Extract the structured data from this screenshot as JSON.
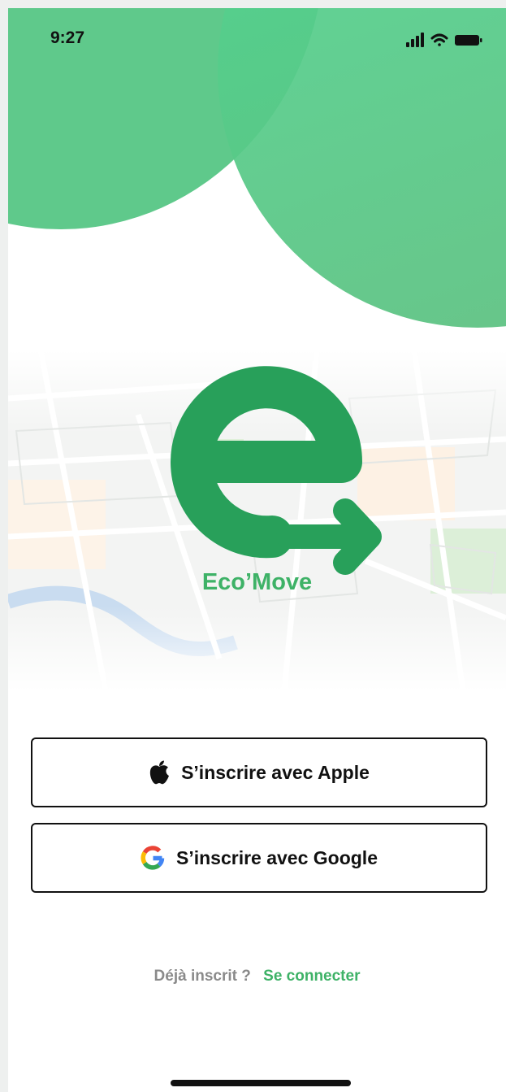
{
  "status_bar": {
    "time": "9:27"
  },
  "brand": {
    "name": "Eco’Move",
    "color": "#3eb267",
    "logo_color": "#28a05a"
  },
  "buttons": {
    "apple_label": "S’inscrire avec Apple",
    "google_label": "S’inscrire avec Google"
  },
  "footer": {
    "prompt": "Déjà inscrit ?",
    "link": "Se connecter"
  },
  "icons": {
    "apple": "apple-logo-icon",
    "google": "google-logo-icon",
    "signal": "cellular-signal-icon",
    "wifi": "wifi-icon",
    "battery": "battery-icon"
  },
  "colors": {
    "accent_green": "#3eb267",
    "circle_green": "#5fc98b"
  }
}
